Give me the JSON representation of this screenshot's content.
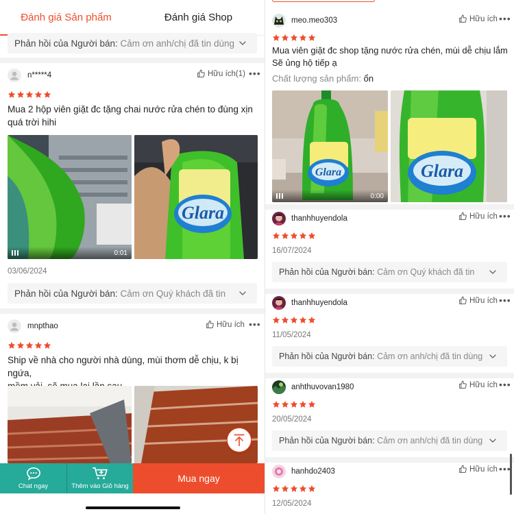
{
  "tabs": [
    {
      "label": "Đánh giá Sản phẩm",
      "active": true
    },
    {
      "label": "Đánh giá Shop",
      "active": false
    }
  ],
  "colors": {
    "accent": "#ee4d2d",
    "star": "#ee4d2d",
    "chat_green": "#26aa99"
  },
  "left": {
    "reply_top": {
      "label": "Phản hồi của Người bán:",
      "content": "Cảm ơn anh/chị đã tin dùng"
    },
    "review1": {
      "username": "n*****4",
      "helpful": "Hữu ích(1)",
      "rating": 5,
      "text_line1": "Mua 2 hộp viên giặt đc tặng chai nước rửa chén to đùng xịn",
      "text_line2": "quá trời hihi",
      "video_duration": "0:01",
      "date": "03/06/2024",
      "reply": {
        "label": "Phản hồi của Người bán:",
        "content": "Cảm ơn Quý khách đã tin"
      }
    },
    "review2": {
      "username": "mnpthao",
      "helpful": "Hữu ích",
      "rating": 5,
      "text_line1": "Ship về nhà cho người nhà dùng, mùi thơm dễ chịu, k bị ngứa,",
      "text_line2": "mềm vải, sẽ mua lại lần sau"
    },
    "bottom_bar": {
      "chat_label": "Chat ngay",
      "cart_label": "Thêm vào Giỏ hàng",
      "buy_label": "Mua ngay"
    }
  },
  "right": {
    "review1": {
      "username": "meo.meo303",
      "helpful": "Hữu ích",
      "rating": 5,
      "text_line1": "Mua viên giặt đc shop tặng nước rửa chén, mùi dễ chịu lắm",
      "text_line2": "Sẽ ủng hộ tiếp ạ",
      "quality_label": "Chất lượng sản phẩm:",
      "quality_value": "ổn",
      "video_duration": "0:00"
    },
    "review2": {
      "username": "thanhhuyendola",
      "helpful": "Hữu ích",
      "rating": 5,
      "date": "16/07/2024",
      "reply": {
        "label": "Phản hồi của Người bán:",
        "content": "Cảm ơn Quý khách đã tin"
      }
    },
    "review3": {
      "username": "thanhhuyendola",
      "helpful": "Hữu ích",
      "rating": 5,
      "date": "11/05/2024",
      "reply": {
        "label": "Phản hồi của Người bán:",
        "content": "Cảm ơn anh/chị đã tin dùng"
      }
    },
    "review4": {
      "username": "anhthuvovan1980",
      "helpful": "Hữu ích",
      "rating": 5,
      "date": "20/05/2024",
      "reply": {
        "label": "Phản hồi của Người bán:",
        "content": "Cảm ơn anh/chị đã tin dùng"
      }
    },
    "review5": {
      "username": "hanhdo2403",
      "helpful": "Hữu ích",
      "rating": 5,
      "date": "12/05/2024"
    }
  }
}
